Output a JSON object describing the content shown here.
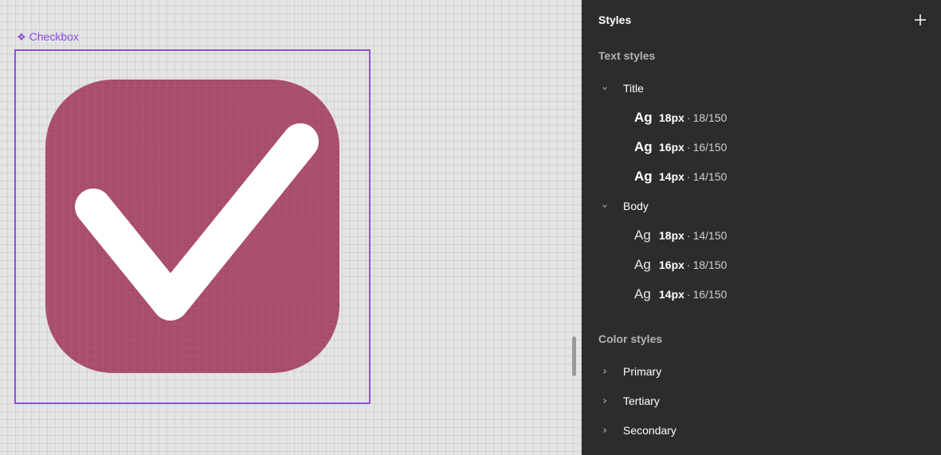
{
  "canvas": {
    "component_label": "Checkbox",
    "component_icon": "component-diamond-icon",
    "accent_color": "#8a4fe0",
    "checkbox_fill": "#a84d6b",
    "check_color": "#ffffff"
  },
  "panel": {
    "title": "Styles",
    "add_icon": "plus-icon",
    "text_styles_label": "Text styles",
    "text_groups": [
      {
        "name": "Title",
        "expanded": true,
        "styles": [
          {
            "sample": "Ag",
            "size": "18px",
            "line": "18/150"
          },
          {
            "sample": "Ag",
            "size": "16px",
            "line": "16/150"
          },
          {
            "sample": "Ag",
            "size": "14px",
            "line": "14/150"
          }
        ]
      },
      {
        "name": "Body",
        "expanded": true,
        "styles": [
          {
            "sample": "Ag",
            "size": "18px",
            "line": "14/150"
          },
          {
            "sample": "Ag",
            "size": "16px",
            "line": "18/150"
          },
          {
            "sample": "Ag",
            "size": "14px",
            "line": "16/150"
          }
        ]
      }
    ],
    "color_styles_label": "Color styles",
    "color_groups": [
      {
        "name": "Primary",
        "expanded": false
      },
      {
        "name": "Tertiary",
        "expanded": false
      },
      {
        "name": "Secondary",
        "expanded": false
      }
    ],
    "separator": "·"
  }
}
